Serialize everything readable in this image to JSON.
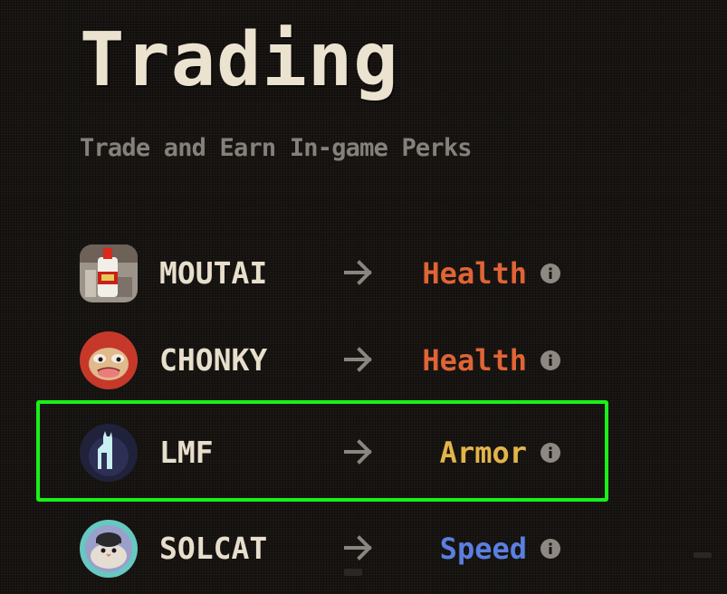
{
  "header": {
    "title": "Trading",
    "subtitle": "Trade and Earn In-game Perks"
  },
  "trades": [
    {
      "token": "MOUTAI",
      "perk": "Health",
      "perk_color": "#e06435",
      "avatar_icon": "moutai-bottle-icon",
      "arrow_icon": "arrow-right-icon",
      "info_icon": "info-icon"
    },
    {
      "token": "CHONKY",
      "perk": "Health",
      "perk_color": "#e06435",
      "avatar_icon": "chonky-frog-icon",
      "arrow_icon": "arrow-right-icon",
      "info_icon": "info-icon"
    },
    {
      "token": "LMF",
      "perk": "Armor",
      "perk_color": "#e2b54a",
      "avatar_icon": "llama-icon",
      "arrow_icon": "arrow-right-icon",
      "info_icon": "info-icon",
      "highlighted": true
    },
    {
      "token": "SOLCAT",
      "perk": "Speed",
      "perk_color": "#5a7fe0",
      "avatar_icon": "solcat-icon",
      "arrow_icon": "arrow-right-icon",
      "info_icon": "info-icon"
    }
  ],
  "colors": {
    "background": "#171411",
    "title": "#ebe3cf",
    "subtitle": "#86807a",
    "highlight_border": "#19f019"
  }
}
